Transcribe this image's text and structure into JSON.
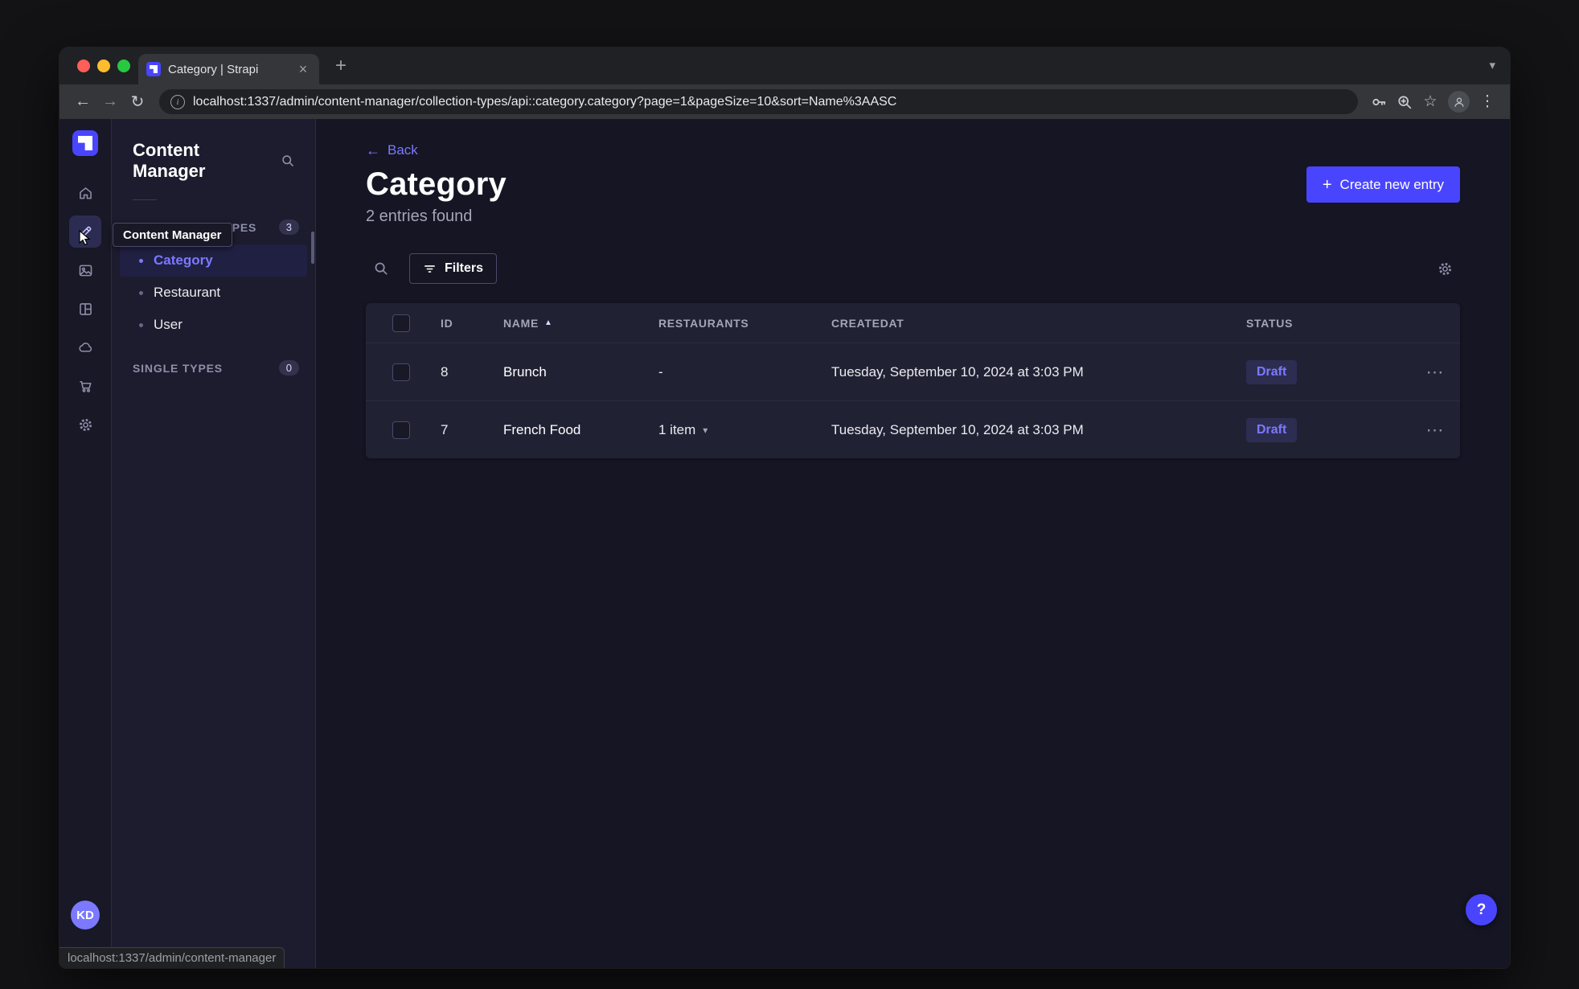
{
  "browser": {
    "tab_title": "Category | Strapi",
    "url": "localhost:1337/admin/content-manager/collection-types/api::category.category?page=1&pageSize=10&sort=Name%3AASC",
    "status_link": "localhost:1337/admin/content-manager"
  },
  "icons": {
    "back_arrow": "←",
    "forward_arrow": "→",
    "reload": "↻",
    "close": "×",
    "new_tab": "+",
    "chevron_down": "▾",
    "star": "☆",
    "menu_dots": "⋮",
    "row_dots": "⋯",
    "sort_asc": "▲",
    "caret_down": "▾",
    "help": "?",
    "info": "i",
    "plus": "+"
  },
  "rail": {
    "tooltip": "Content Manager",
    "avatar_initials": "KD"
  },
  "subnav": {
    "title": "Content Manager",
    "collection_types": {
      "label": "COLLECTION TYPES",
      "count": "3",
      "items": [
        {
          "label": "Category"
        },
        {
          "label": "Restaurant"
        },
        {
          "label": "User"
        }
      ]
    },
    "single_types": {
      "label": "SINGLE TYPES",
      "count": "0"
    }
  },
  "page": {
    "back_label": "Back",
    "title": "Category",
    "subtitle": "2 entries found",
    "create_button": "Create new entry",
    "filters_button": "Filters"
  },
  "table": {
    "headers": {
      "id": "ID",
      "name": "NAME",
      "restaurants": "RESTAURANTS",
      "createdat": "CREATEDAT",
      "status": "STATUS"
    },
    "rows": [
      {
        "id": "8",
        "name": "Brunch",
        "restaurants": "-",
        "createdat": "Tuesday, September 10, 2024 at 3:03 PM",
        "status": "Draft"
      },
      {
        "id": "7",
        "name": "French Food",
        "restaurants": "1 item",
        "createdat": "Tuesday, September 10, 2024 at 3:03 PM",
        "status": "Draft"
      }
    ]
  },
  "colors": {
    "primary": "#4945ff",
    "primary_light": "#7b79ff",
    "traffic_red": "#ff5f57",
    "traffic_yellow": "#febc2e",
    "traffic_green": "#28c840"
  }
}
